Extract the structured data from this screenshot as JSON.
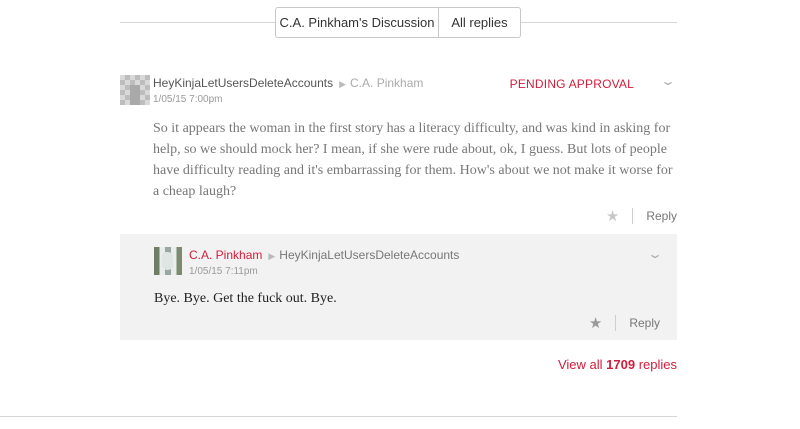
{
  "tabs": [
    {
      "label": "C.A. Pinkham's Discussion"
    },
    {
      "label": "All replies"
    }
  ],
  "main_comment": {
    "author": "HeyKinjaLetUsersDeleteAccounts",
    "reply_to": "C.A. Pinkham",
    "timestamp": "1/05/15 7:00pm",
    "status": "PENDING APPROVAL",
    "body": "So it appears the woman in the first story has a literacy difficulty, and was kind in asking for help, so we should mock her? I mean, if she were rude about, ok, I guess. But lots of people have difficulty reading and it's embarrassing for them. How's about we not make it worse for a cheap laugh?",
    "reply_label": "Reply"
  },
  "reply_comment": {
    "author": "C.A. Pinkham",
    "reply_to": "HeyKinjaLetUsersDeleteAccounts",
    "timestamp": "1/05/15 7:11pm",
    "body": "Bye. Bye. Get the fuck out. Bye.",
    "reply_label": "Reply"
  },
  "view_all": {
    "prefix": "View all",
    "count": "1709",
    "suffix": "replies"
  },
  "icons": {
    "reply_arrow": "reply-arrow-icon",
    "chevron": "chevron-down-icon",
    "star": "star-icon"
  },
  "colors": {
    "accent": "#d11d3b",
    "reply_background": "#f2f2f2"
  }
}
